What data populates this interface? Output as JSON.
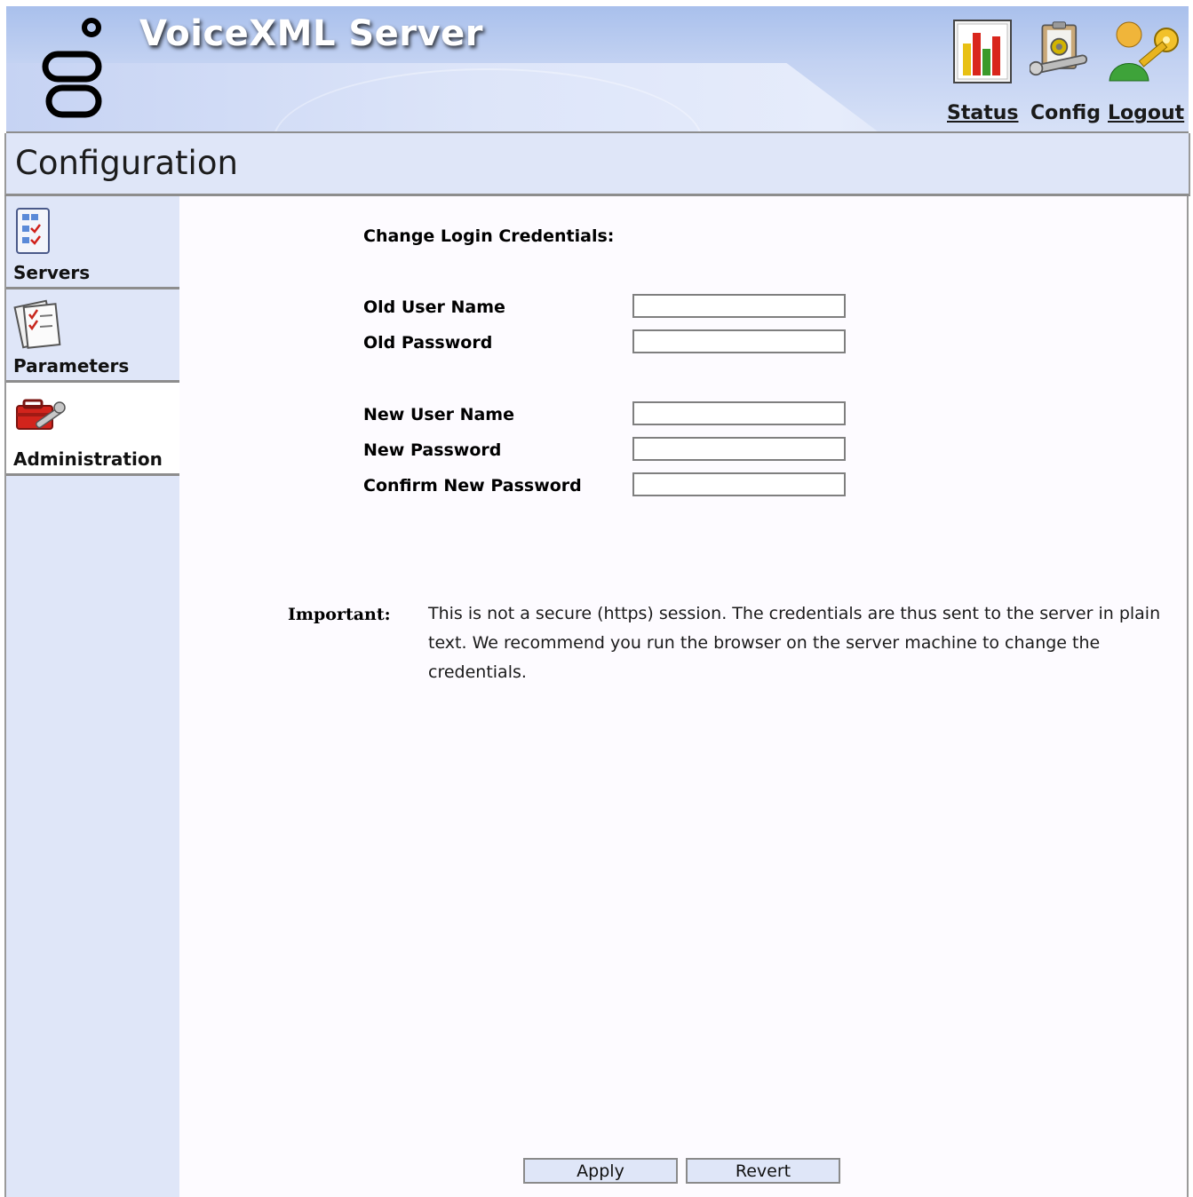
{
  "header": {
    "app_title": "VoiceXML Server",
    "nav": {
      "status_label": "Status",
      "config_label": "Config",
      "logout_label": "Logout"
    },
    "icons": [
      "bar-chart-icon",
      "config-clipboard-icon",
      "user-key-icon"
    ]
  },
  "page": {
    "title": "Configuration"
  },
  "sidebar": {
    "items": [
      {
        "label": "Servers",
        "icon": "servers-checklist-icon",
        "active": false
      },
      {
        "label": "Parameters",
        "icon": "parameters-document-icon",
        "active": false
      },
      {
        "label": "Administration",
        "icon": "toolbox-wrench-icon",
        "active": true
      }
    ]
  },
  "form": {
    "heading": "Change Login Credentials:",
    "fields": {
      "old_user_name": {
        "label": "Old User Name",
        "value": ""
      },
      "old_password": {
        "label": "Old Password",
        "value": ""
      },
      "new_user_name": {
        "label": "New User Name",
        "value": ""
      },
      "new_password": {
        "label": "New Password",
        "value": ""
      },
      "confirm_new_password": {
        "label": "Confirm New Password",
        "value": ""
      }
    }
  },
  "notice": {
    "label": "Important:",
    "text": "This is not a secure (https) session. The credentials are thus sent to the server in plain text. We recommend you run the browser on the server machine to change the credentials."
  },
  "buttons": {
    "apply": "Apply",
    "revert": "Revert"
  },
  "colors": {
    "header_blue": "#a9c0ec",
    "panel_blue": "#dfe6f8",
    "border_gray": "#8d8d8d"
  }
}
